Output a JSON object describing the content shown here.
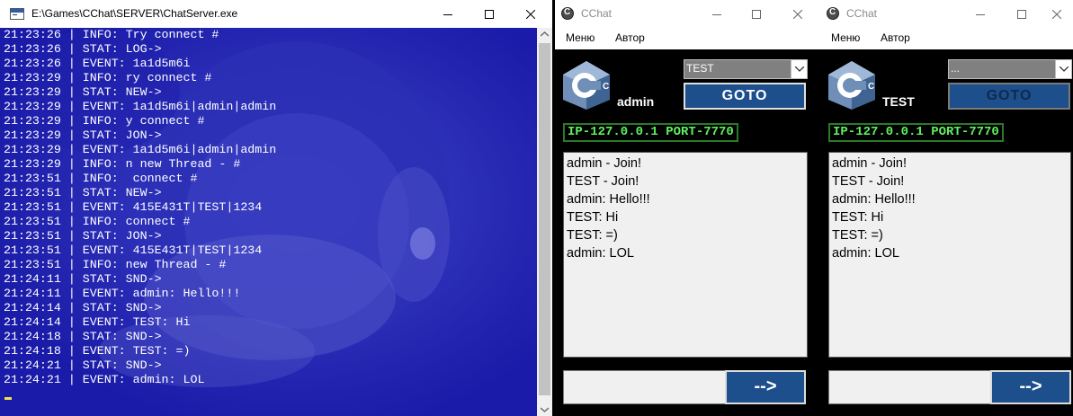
{
  "console": {
    "title": "E:\\Games\\CChat\\SERVER\\ChatServer.exe",
    "lines": [
      "21:23:26 | INFO: Try connect #",
      "21:23:26 | STAT: LOG->",
      "21:23:26 | EVENT: 1a1d5m6i",
      "21:23:29 | INFO: ry connect #",
      "21:23:29 | STAT: NEW->",
      "21:23:29 | EVENT: 1a1d5m6i|admin|admin",
      "21:23:29 | INFO: y connect #",
      "21:23:29 | STAT: JON->",
      "21:23:29 | EVENT: 1a1d5m6i|admin|admin",
      "21:23:29 | INFO: n new Thread - #",
      "21:23:51 | INFO:  connect #",
      "21:23:51 | STAT: NEW->",
      "21:23:51 | EVENT: 415E431T|TEST|1234",
      "21:23:51 | INFO: connect #",
      "21:23:51 | STAT: JON->",
      "21:23:51 | EVENT: 415E431T|TEST|1234",
      "21:23:51 | INFO: new Thread - #",
      "21:24:11 | STAT: SND->",
      "21:24:11 | EVENT: admin: Hello!!!",
      "21:24:14 | STAT: SND->",
      "21:24:14 | EVENT: TEST: Hi",
      "21:24:18 | STAT: SND->",
      "21:24:18 | EVENT: TEST: =)",
      "21:24:21 | STAT: SND->",
      "21:24:21 | EVENT: admin: LOL"
    ]
  },
  "chat_left": {
    "title": "CChat",
    "menu": [
      "Меню",
      "Автор"
    ],
    "username": "admin",
    "combo_value": "TEST",
    "goto_label": "GOTO",
    "ip_label": "IP-127.0.0.1 PORT-7770",
    "log": [
      "admin - Join!",
      "TEST - Join!",
      "admin: Hello!!!",
      "TEST: Hi",
      "TEST: =)",
      "admin: LOL"
    ],
    "input_value": "",
    "send_label": "-->"
  },
  "chat_right": {
    "title": "CChat",
    "menu": [
      "Меню",
      "Автор"
    ],
    "username": "TEST",
    "combo_value": "...",
    "goto_label": "GOTO",
    "ip_label": "IP-127.0.0.1 PORT-7770",
    "log": [
      "admin - Join!",
      "TEST - Join!",
      "admin: Hello!!!",
      "TEST: Hi",
      "TEST: =)",
      "admin: LOL"
    ],
    "input_value": "",
    "send_label": "-->"
  },
  "colors": {
    "console_bg": "#1a1ba8",
    "button_blue": "#1d4f8c",
    "ip_green": "#5ff05f"
  }
}
